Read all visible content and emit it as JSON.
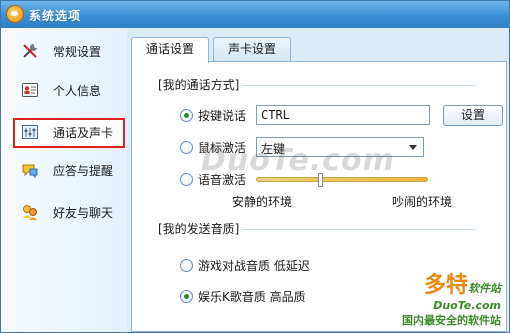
{
  "window": {
    "title": "系统选项"
  },
  "sidebar": {
    "items": [
      {
        "label": "常规设置",
        "icon": "tools-icon"
      },
      {
        "label": "个人信息",
        "icon": "id-card-icon"
      },
      {
        "label": "通话及声卡",
        "icon": "equalizer-icon",
        "selected": true
      },
      {
        "label": "应答与提醒",
        "icon": "chat-bubble-icon"
      },
      {
        "label": "好友与聊天",
        "icon": "friends-icon"
      }
    ]
  },
  "tabs": [
    {
      "label": "通话设置",
      "active": true
    },
    {
      "label": "声卡设置",
      "active": false
    }
  ],
  "call_mode": {
    "group_label": "[我的通话方式]",
    "hotkey": {
      "label": "按键说话",
      "value": "CTRL",
      "button": "设置",
      "checked": true
    },
    "mouse": {
      "label": "鼠标激活",
      "selected": "左键",
      "checked": false
    },
    "voice": {
      "label": "语音激活",
      "checked": false,
      "level": 0.37,
      "min_label": "安静的环境",
      "max_label": "吵闹的环境"
    }
  },
  "quality": {
    "group_label": "[我的发送音质]",
    "options": [
      {
        "label": "游戏对战音质 低延迟",
        "checked": false
      },
      {
        "label": "娱乐K歌音质 高品质",
        "checked": true
      }
    ]
  },
  "watermark": {
    "center": "DuoTe.com",
    "brand": "多特",
    "brand_suffix": "软件站",
    "domain": "DuoTe.com",
    "tagline": "国内最安全的软件站"
  },
  "colors": {
    "accent": "#3a8fd4",
    "highlight_border": "#e0201e",
    "radio_dot": "#2b8a2b"
  }
}
